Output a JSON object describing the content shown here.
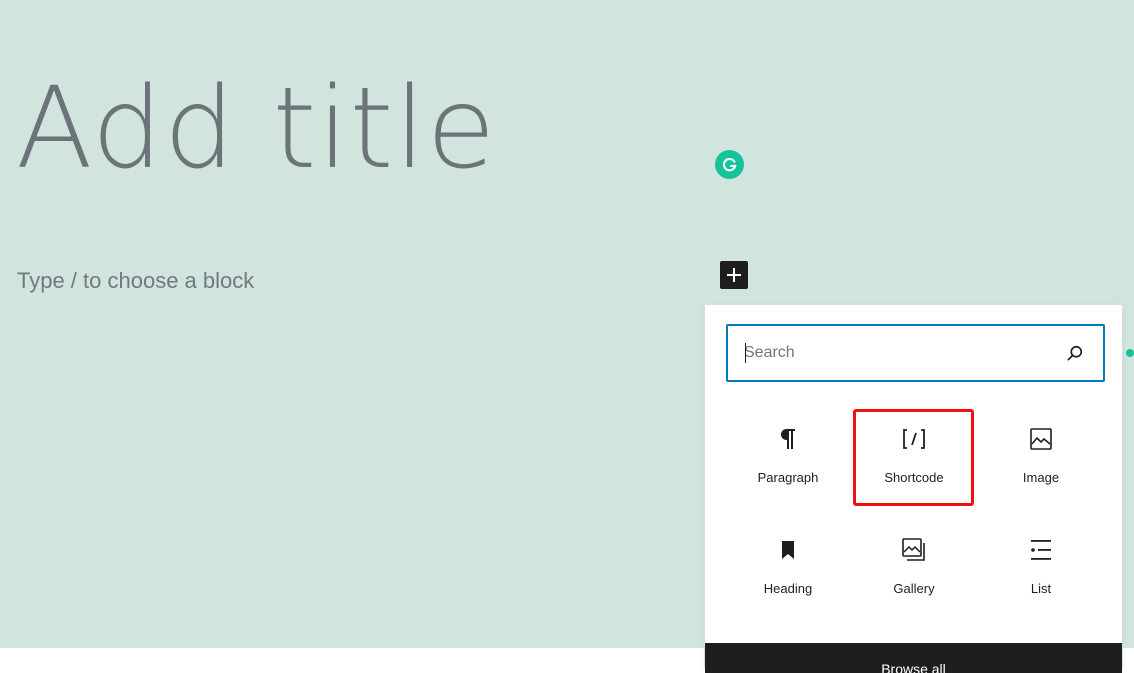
{
  "editor": {
    "title_placeholder": "Add title",
    "block_placeholder": "Type / to choose a block"
  },
  "inserter": {
    "search": {
      "placeholder": "Search",
      "value": ""
    },
    "blocks": [
      {
        "label": "Paragraph",
        "icon": "paragraph-icon"
      },
      {
        "label": "Shortcode",
        "icon": "shortcode-icon"
      },
      {
        "label": "Image",
        "icon": "image-icon"
      },
      {
        "label": "Heading",
        "icon": "heading-icon"
      },
      {
        "label": "Gallery",
        "icon": "gallery-icon"
      },
      {
        "label": "List",
        "icon": "list-icon"
      }
    ],
    "browse_all_label": "Browse all",
    "highlighted_block": "Shortcode"
  },
  "colors": {
    "canvas_bg": "#d1e4dd",
    "accent": "#007cba",
    "grammarly": "#15c39a",
    "highlight": "#ee1111"
  }
}
